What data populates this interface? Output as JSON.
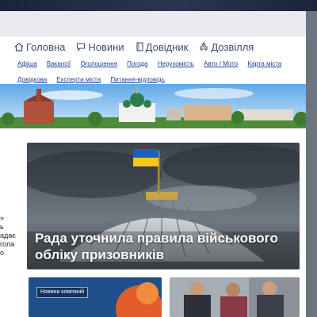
{
  "nav": {
    "items": [
      {
        "label": "Головна",
        "icon": "home-icon"
      },
      {
        "label": "Новини",
        "icon": "speech-bubble-icon"
      },
      {
        "label": "Довідник",
        "icon": "book-icon"
      },
      {
        "label": "Дозвілля",
        "icon": "leisure-icon"
      }
    ]
  },
  "subnav": {
    "links": [
      "Афіша",
      "Вакансії",
      "Оголошення",
      "Погода",
      "Нерухомість",
      "Авто / Мото",
      "Карта міста",
      "Довідкова",
      "Експерти міста",
      "Питання-відповідь"
    ]
  },
  "sidebar": {
    "lines": [
      "»",
      "ь",
      "адає",
      "гола",
      "о"
    ]
  },
  "hero": {
    "title": "Рада уточнила правила військового обліку призовників"
  },
  "cards": {
    "left_badge": "Новини компаній"
  },
  "colors": {
    "nav_text": "#3d4e6b",
    "link": "#1e3f9a",
    "flag_blue": "#1f5fbf",
    "flag_yellow": "#f3c623"
  }
}
